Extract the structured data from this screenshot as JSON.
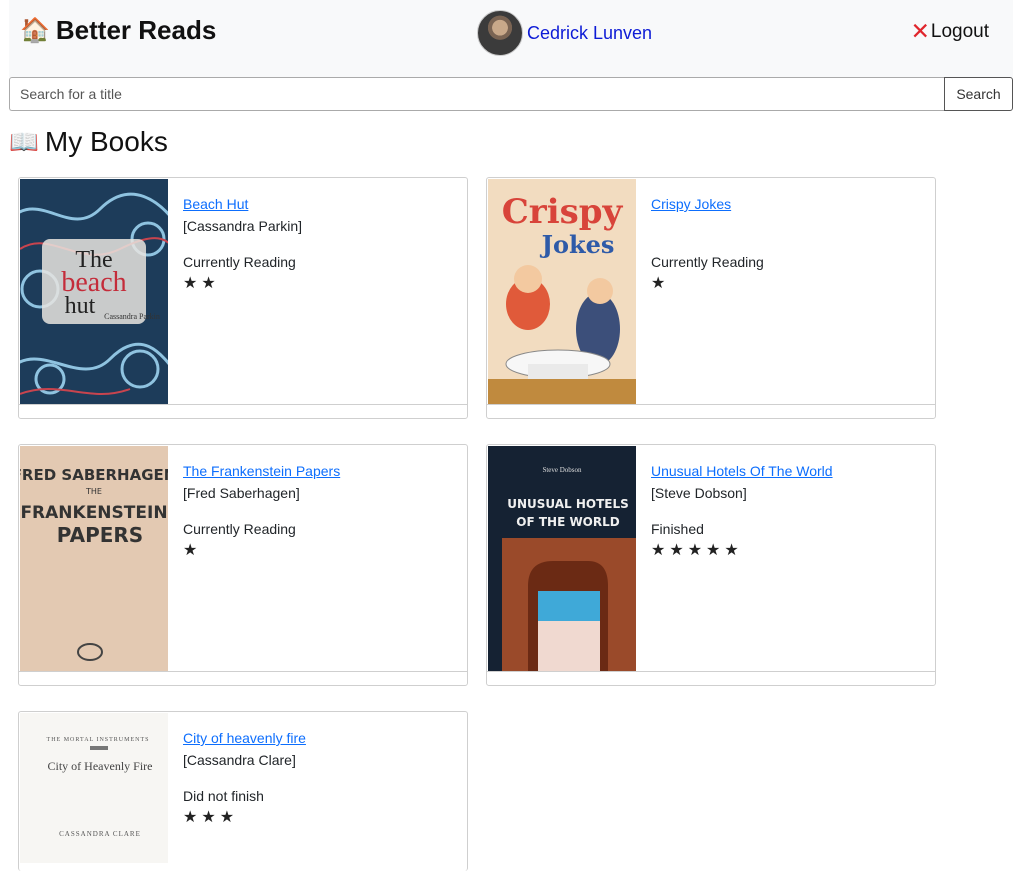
{
  "header": {
    "brand": "Better Reads",
    "brand_icon": "house-icon",
    "user_name": "Cedrick Lunven",
    "logout_label": "Logout",
    "logout_icon": "x-icon"
  },
  "search": {
    "placeholder": "Search for a title",
    "value": "",
    "button_label": "Search"
  },
  "section": {
    "title": "My Books",
    "icon": "open-book-icon"
  },
  "books": [
    {
      "title": "Beach Hut",
      "author": "[Cassandra Parkin]",
      "status": "Currently Reading",
      "rating": 2,
      "stars": "★★",
      "cover": {
        "line1": "The",
        "line2": "beach",
        "line3": "hut",
        "byline": "Cassandra Parkin"
      }
    },
    {
      "title": "Crispy Jokes",
      "author": "",
      "status": "Currently Reading",
      "rating": 1,
      "stars": "★",
      "cover": {
        "line1": "Crispy",
        "line2": "Jokes"
      }
    },
    {
      "title": "The Frankenstein Papers",
      "author": "[Fred Saberhagen]",
      "status": "Currently Reading",
      "rating": 1,
      "stars": "★",
      "cover": {
        "line1": "FRED SABERHAGEN",
        "line2": "THE",
        "line3": "FRANKENSTEIN",
        "line4": "PAPERS"
      }
    },
    {
      "title": "Unusual Hotels Of The World",
      "author": "[Steve Dobson]",
      "status": "Finished",
      "rating": 5,
      "stars": "★★★★★",
      "cover": {
        "byline": "Steve Dobson",
        "line1": "UNUSUAL HOTELS",
        "line2": "OF THE WORLD"
      }
    },
    {
      "title": "City of heavenly fire",
      "author": "[Cassandra Clare]",
      "status": "Did not finish",
      "rating": 3,
      "stars": "★★★",
      "cover": {
        "series": "THE MORTAL INSTRUMENTS",
        "line1": "City of Heavenly Fire",
        "byline": "CASSANDRA CLARE"
      }
    }
  ]
}
